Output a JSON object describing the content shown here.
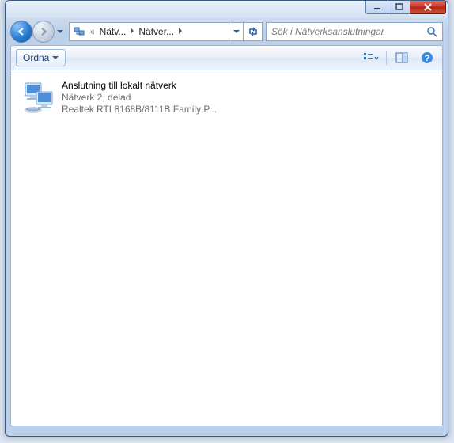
{
  "window_controls": {
    "minimize": "minimize",
    "maximize": "maximize",
    "close": "close"
  },
  "breadcrumbs": {
    "prefix": "«",
    "part1": "Nätv...",
    "part2": "Nätver..."
  },
  "search": {
    "placeholder": "Sök i Nätverksanslutningar"
  },
  "toolbar": {
    "organize_label": "Ordna"
  },
  "item": {
    "title": "Anslutning till lokalt nätverk",
    "line2": "Nätverk  2, delad",
    "line3": "Realtek RTL8168B/8111B Family P..."
  }
}
